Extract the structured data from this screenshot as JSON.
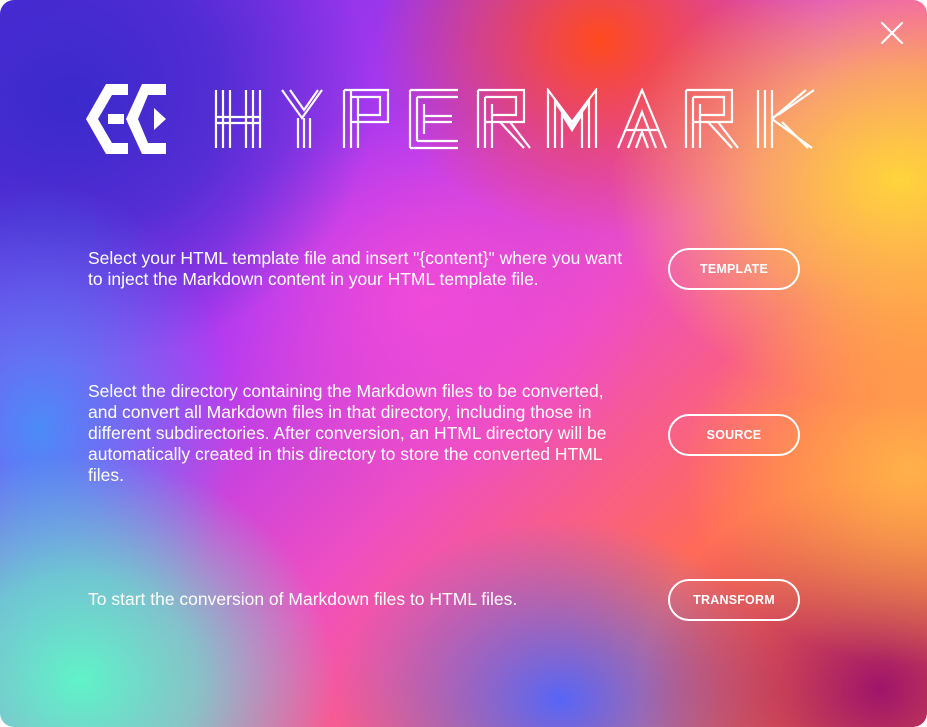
{
  "app": {
    "wordmark": "HYPERMARK",
    "logo_initials": "EC"
  },
  "icons": {
    "close": "close-icon",
    "logo": "ec-logo-icon"
  },
  "sections": [
    {
      "description": "Select your HTML template file and insert \"{content}\" where you want to inject the Markdown content in your HTML template file.",
      "button_label": "TEMPLATE"
    },
    {
      "description": "Select the directory containing the Markdown files to be converted, and convert all Markdown files in that directory, including those in different subdirectories. After conversion, an HTML directory will be automatically created in this directory to store the converted HTML files.",
      "button_label": "SOURCE"
    },
    {
      "description": "To start the conversion of Markdown files to HTML files.",
      "button_label": "TRANSFORM"
    }
  ],
  "colors": {
    "text": "#ffffff",
    "button_border": "#ffffff"
  }
}
